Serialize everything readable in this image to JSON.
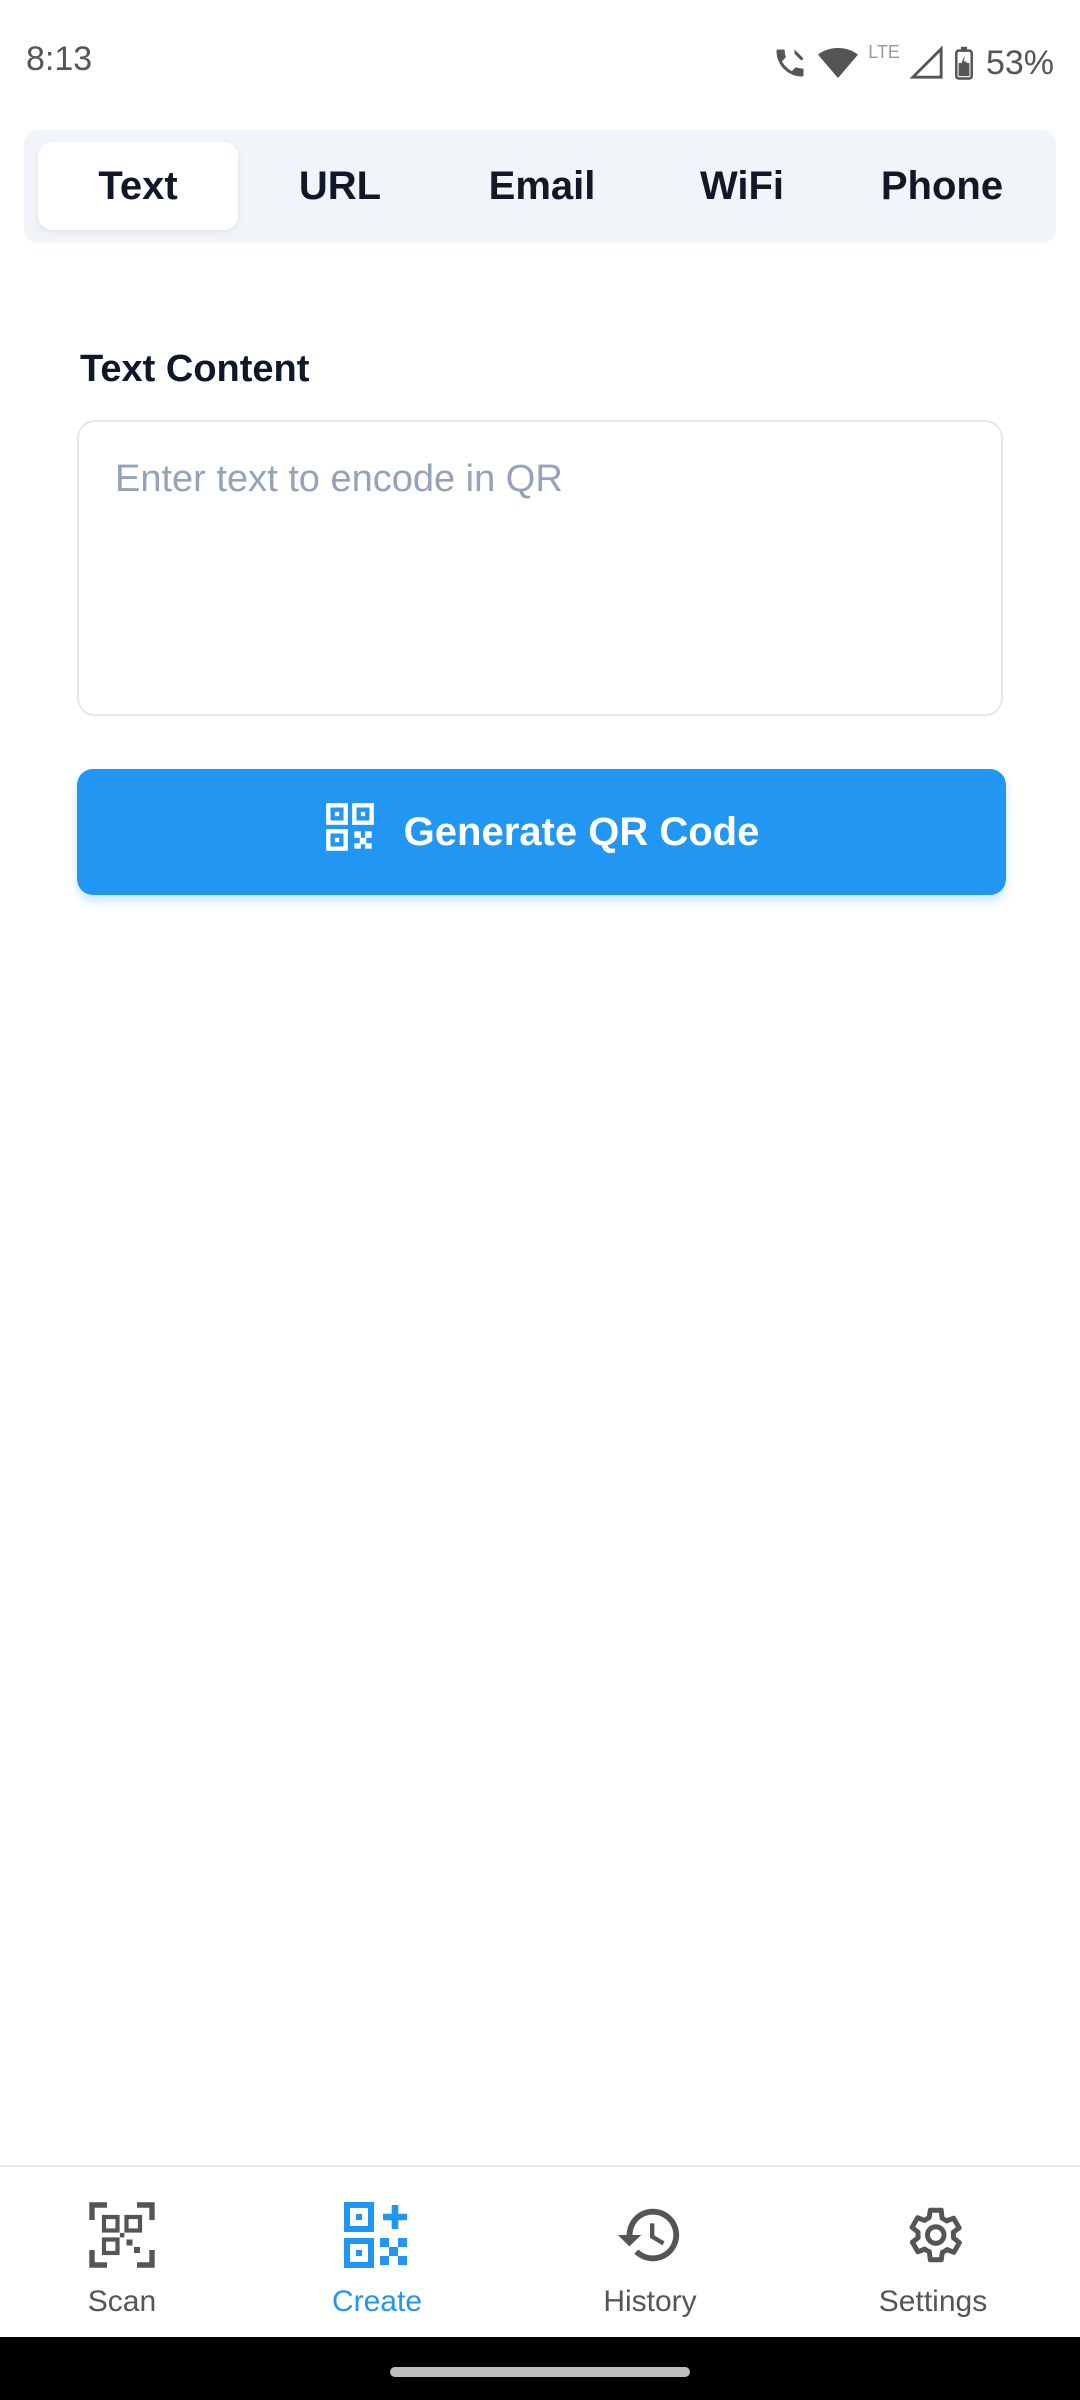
{
  "status": {
    "time": "8:13",
    "network": "LTE",
    "battery": "53%"
  },
  "tabs": [
    {
      "label": "Text",
      "active": true
    },
    {
      "label": "URL",
      "active": false
    },
    {
      "label": "Email",
      "active": false
    },
    {
      "label": "WiFi",
      "active": false
    },
    {
      "label": "Phone",
      "active": false
    }
  ],
  "form": {
    "label": "Text Content",
    "placeholder": "Enter text to encode in QR",
    "value": ""
  },
  "button": {
    "label": "Generate QR Code",
    "color": "#2196f3"
  },
  "nav": [
    {
      "label": "Scan",
      "icon": "qr-scan-icon",
      "active": false
    },
    {
      "label": "Create",
      "icon": "qr-create-icon",
      "active": true
    },
    {
      "label": "History",
      "icon": "history-icon",
      "active": false
    },
    {
      "label": "Settings",
      "icon": "gear-icon",
      "active": false
    }
  ],
  "colors": {
    "accent": "#2196f3",
    "text": "#0f172a",
    "muted": "#94a3b8"
  }
}
